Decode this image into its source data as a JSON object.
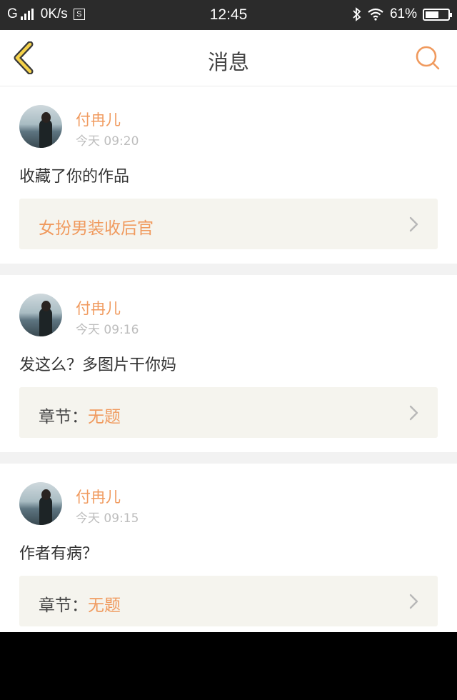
{
  "status_bar": {
    "carrier": "G",
    "network_speed": "0K/s",
    "sim_badge": "S",
    "time": "12:45",
    "battery_text": "61%",
    "battery_level": 0.61
  },
  "header": {
    "title": "消息",
    "back_icon": "chevron-left-icon",
    "search_icon": "search-icon",
    "accent": "#f09a5e"
  },
  "messages": [
    {
      "user": "付冉儿",
      "time": "今天 09:20",
      "text": "收藏了你的作品",
      "ref_prefix": "",
      "ref_value": "女扮男装收后官"
    },
    {
      "user": "付冉儿",
      "time": "今天 09:16",
      "text": "发这么？多图片干你妈",
      "ref_prefix": "章节：",
      "ref_value": "无题"
    },
    {
      "user": "付冉儿",
      "time": "今天 09:15",
      "text": "作者有病？",
      "ref_prefix": "章节：",
      "ref_value": "无题"
    }
  ]
}
